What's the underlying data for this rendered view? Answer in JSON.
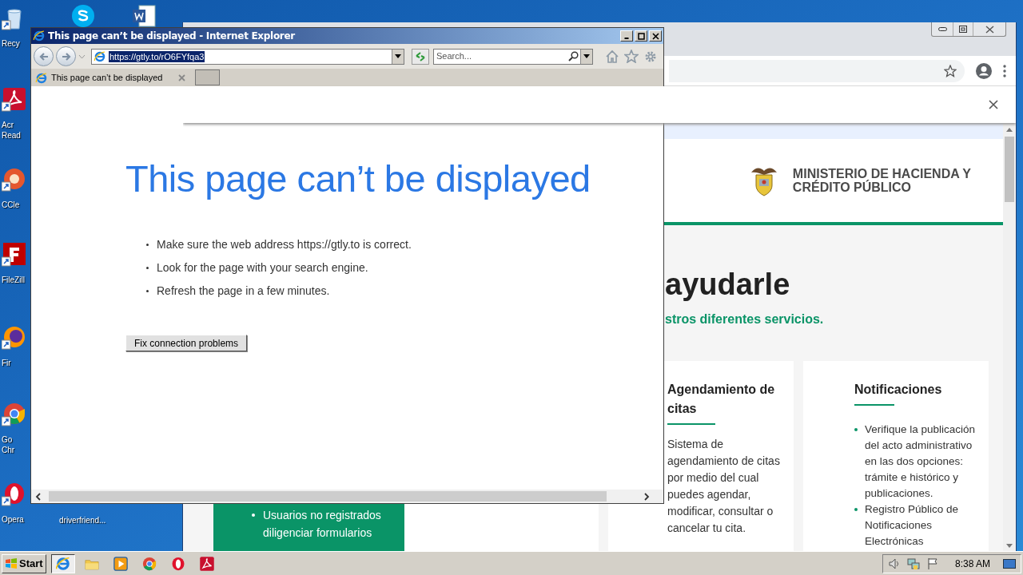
{
  "desktop_icons": [
    {
      "kind": "recycle",
      "lines": [
        "Recy"
      ]
    },
    {
      "kind": "acrobat",
      "lines": [
        "Acr",
        "Read"
      ]
    },
    {
      "kind": "ccleaner",
      "lines": [
        "CCle"
      ]
    },
    {
      "kind": "filezilla",
      "lines": [
        "FileZill"
      ]
    },
    {
      "kind": "firefox",
      "lines": [
        "Fir"
      ]
    },
    {
      "kind": "chrome",
      "lines": [
        "Go",
        "Chr"
      ]
    },
    {
      "kind": "opera",
      "lines": [
        "Opera"
      ]
    },
    {
      "kind": "skype"
    },
    {
      "kind": "word"
    },
    {
      "lines": [
        "driverfriend..."
      ]
    }
  ],
  "chrome_window": {
    "header": {
      "title_lines": [
        "MINISTERIO DE HACIENDA Y",
        "CRÉDITO PÚBLICO"
      ]
    },
    "heading": "ayudarle",
    "subtitle": "stros diferentes servicios.",
    "cards": [
      {
        "kind": "green",
        "bullets": [
          "Usuarios no registrados diligenciar formularios"
        ]
      },
      {
        "kind": "blank"
      },
      {
        "kind": "text",
        "title": "Agendamiento de citas",
        "body": "Sistema de agendamiento de citas por medio del cual puedes agendar, modificar, consultar o cancelar tu cita."
      },
      {
        "kind": "list",
        "title": "Notificaciones",
        "bullets": [
          "Verifique la publicación del acto administrativo en las dos opciones: trámite e histórico y publicaciones.",
          "Registro Público de Notificaciones Electrónicas"
        ]
      }
    ]
  },
  "ie_window": {
    "title": "This page can’t be displayed - Internet Explorer",
    "url": "https://gtly.to/rO6FYfqa3",
    "search_placeholder": "Search...",
    "tabs": [
      {
        "title": "This page can’t be displayed",
        "selected": true
      }
    ],
    "heading": "This page can’t be displayed",
    "tips": [
      "Make sure the web address https://gtly.to is correct.",
      "Look for the page with your search engine.",
      "Refresh the page in a few minutes."
    ],
    "button": "Fix connection problems"
  },
  "taskbar": {
    "start": "Start",
    "apps": [
      {
        "kind": "ie",
        "selected": true
      },
      {
        "kind": "explorer",
        "selected": false
      },
      {
        "kind": "media",
        "selected": false
      },
      {
        "kind": "chrome",
        "selected": false
      },
      {
        "kind": "opera",
        "selected": false
      },
      {
        "kind": "acrobat",
        "selected": false
      }
    ],
    "clock": "8:38 AM"
  }
}
